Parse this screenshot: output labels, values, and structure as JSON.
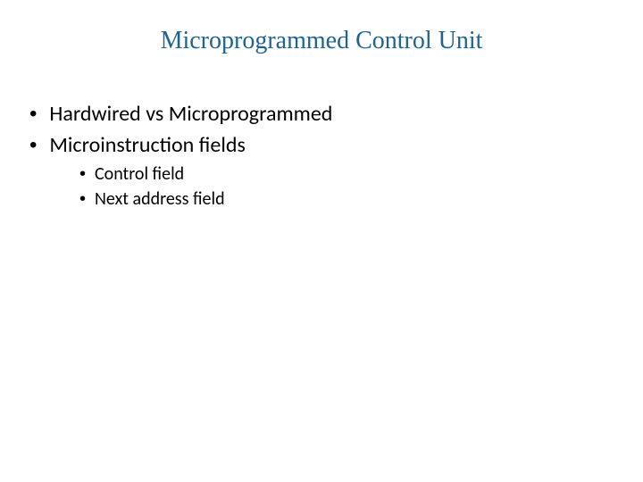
{
  "slide": {
    "title": "Microprogrammed Control Unit",
    "bullets_l1": [
      "Hardwired vs Microprogrammed",
      "Microinstruction fields"
    ],
    "bullets_l2": [
      "Control field",
      "Next address field"
    ]
  }
}
